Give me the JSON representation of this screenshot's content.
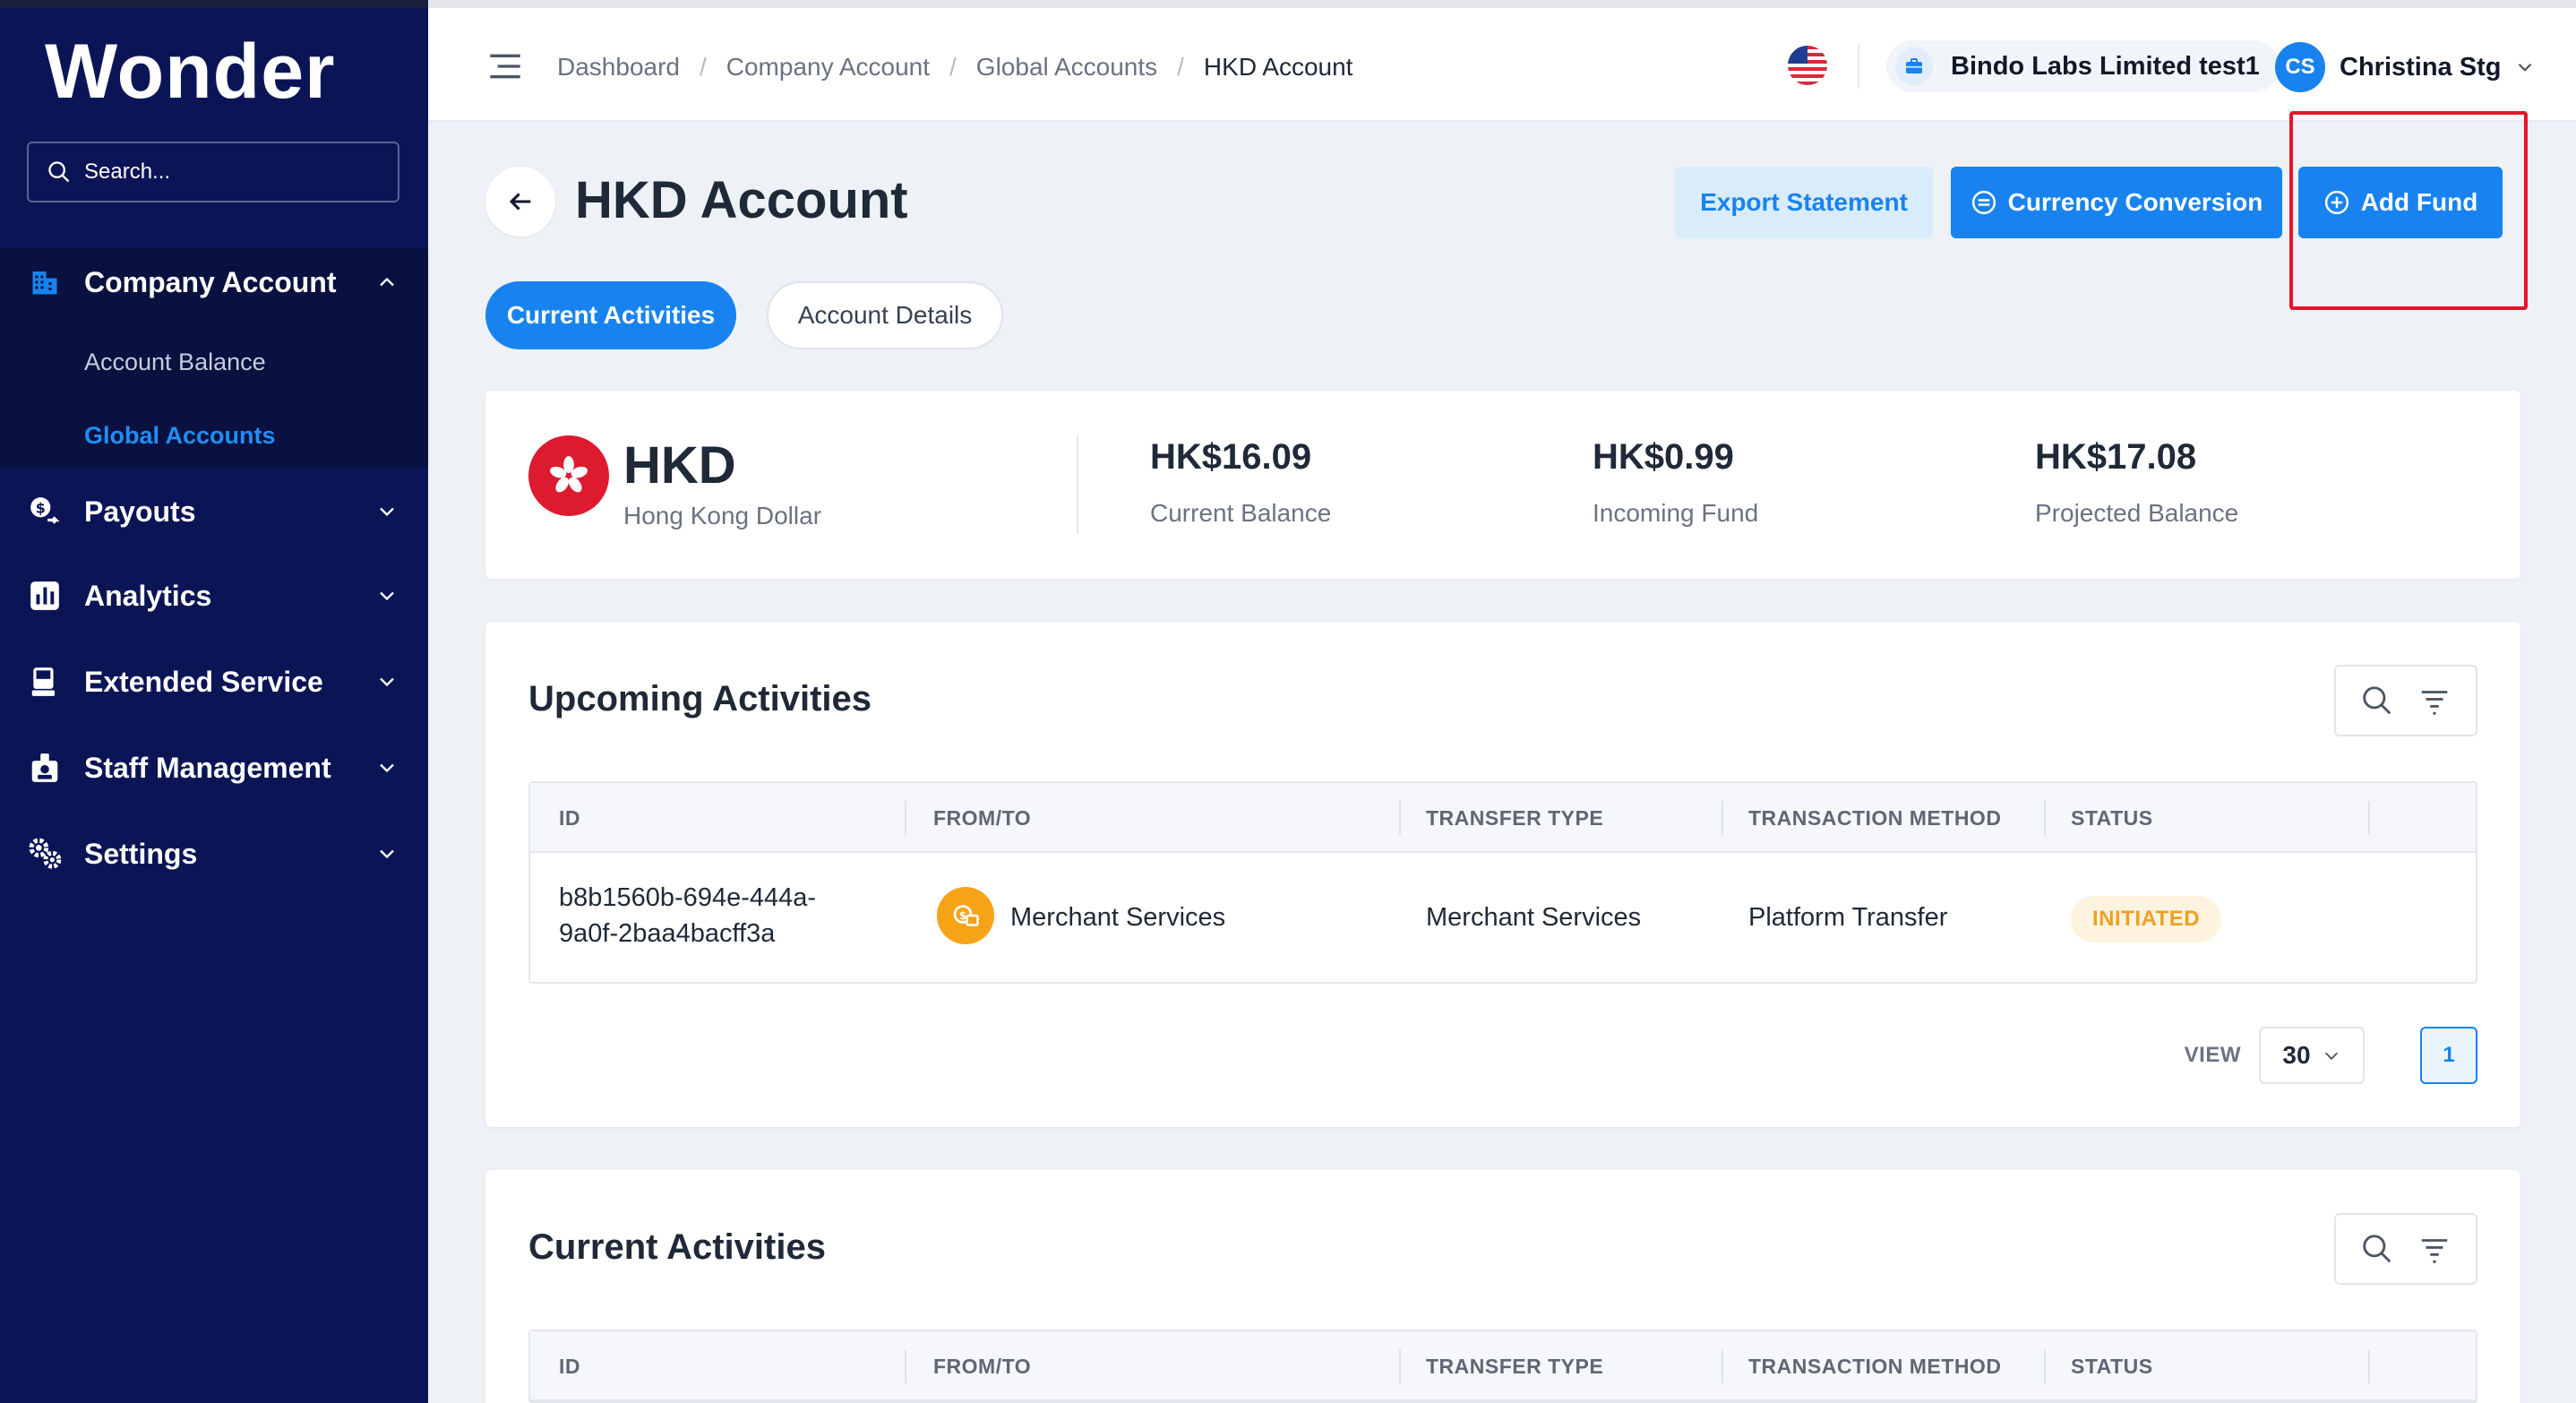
{
  "sidebar": {
    "logo": "Wonder",
    "search_placeholder": "Search...",
    "company_account": {
      "label": "Company Account",
      "children": [
        {
          "label": "Account Balance",
          "active": false
        },
        {
          "label": "Global Accounts",
          "active": true
        }
      ]
    },
    "items": [
      {
        "label": "Payouts"
      },
      {
        "label": "Analytics"
      },
      {
        "label": "Extended Service"
      },
      {
        "label": "Staff Management"
      },
      {
        "label": "Settings"
      }
    ]
  },
  "header": {
    "breadcrumb": [
      "Dashboard",
      "Company Account",
      "Global Accounts",
      "HKD Account"
    ],
    "organization": "Bindo Labs Limited test1",
    "user_initials": "CS",
    "user_name": "Christina Stg"
  },
  "page": {
    "title": "HKD Account",
    "buttons": {
      "export": "Export Statement",
      "convert": "Currency Conversion",
      "add_fund": "Add Fund"
    },
    "tabs": [
      "Current Activities",
      "Account Details"
    ]
  },
  "summary": {
    "currency_code": "HKD",
    "currency_name": "Hong Kong Dollar",
    "stats": [
      {
        "amount": "HK$16.09",
        "label": "Current Balance"
      },
      {
        "amount": "HK$0.99",
        "label": "Incoming Fund"
      },
      {
        "amount": "HK$17.08",
        "label": "Projected Balance"
      }
    ]
  },
  "table_columns": [
    "ID",
    "FROM/TO",
    "TRANSFER TYPE",
    "TRANSACTION METHOD",
    "STATUS"
  ],
  "upcoming": {
    "title": "Upcoming Activities",
    "rows": [
      {
        "id_line1": "b8b1560b-694e-444a-",
        "id_line2": "9a0f-2baa4bacff3a",
        "from_to": "Merchant Services",
        "transfer_type": "Merchant Services",
        "method": "Platform Transfer",
        "status": "INITIATED"
      }
    ],
    "view_label": "VIEW",
    "view_value": "30",
    "page": "1"
  },
  "current": {
    "title": "Current Activities"
  },
  "colors": {
    "sidebar_bg": "#0b1556",
    "primary": "#1883ef",
    "status_initiated": "#f0a020",
    "highlight": "#e4152b"
  }
}
